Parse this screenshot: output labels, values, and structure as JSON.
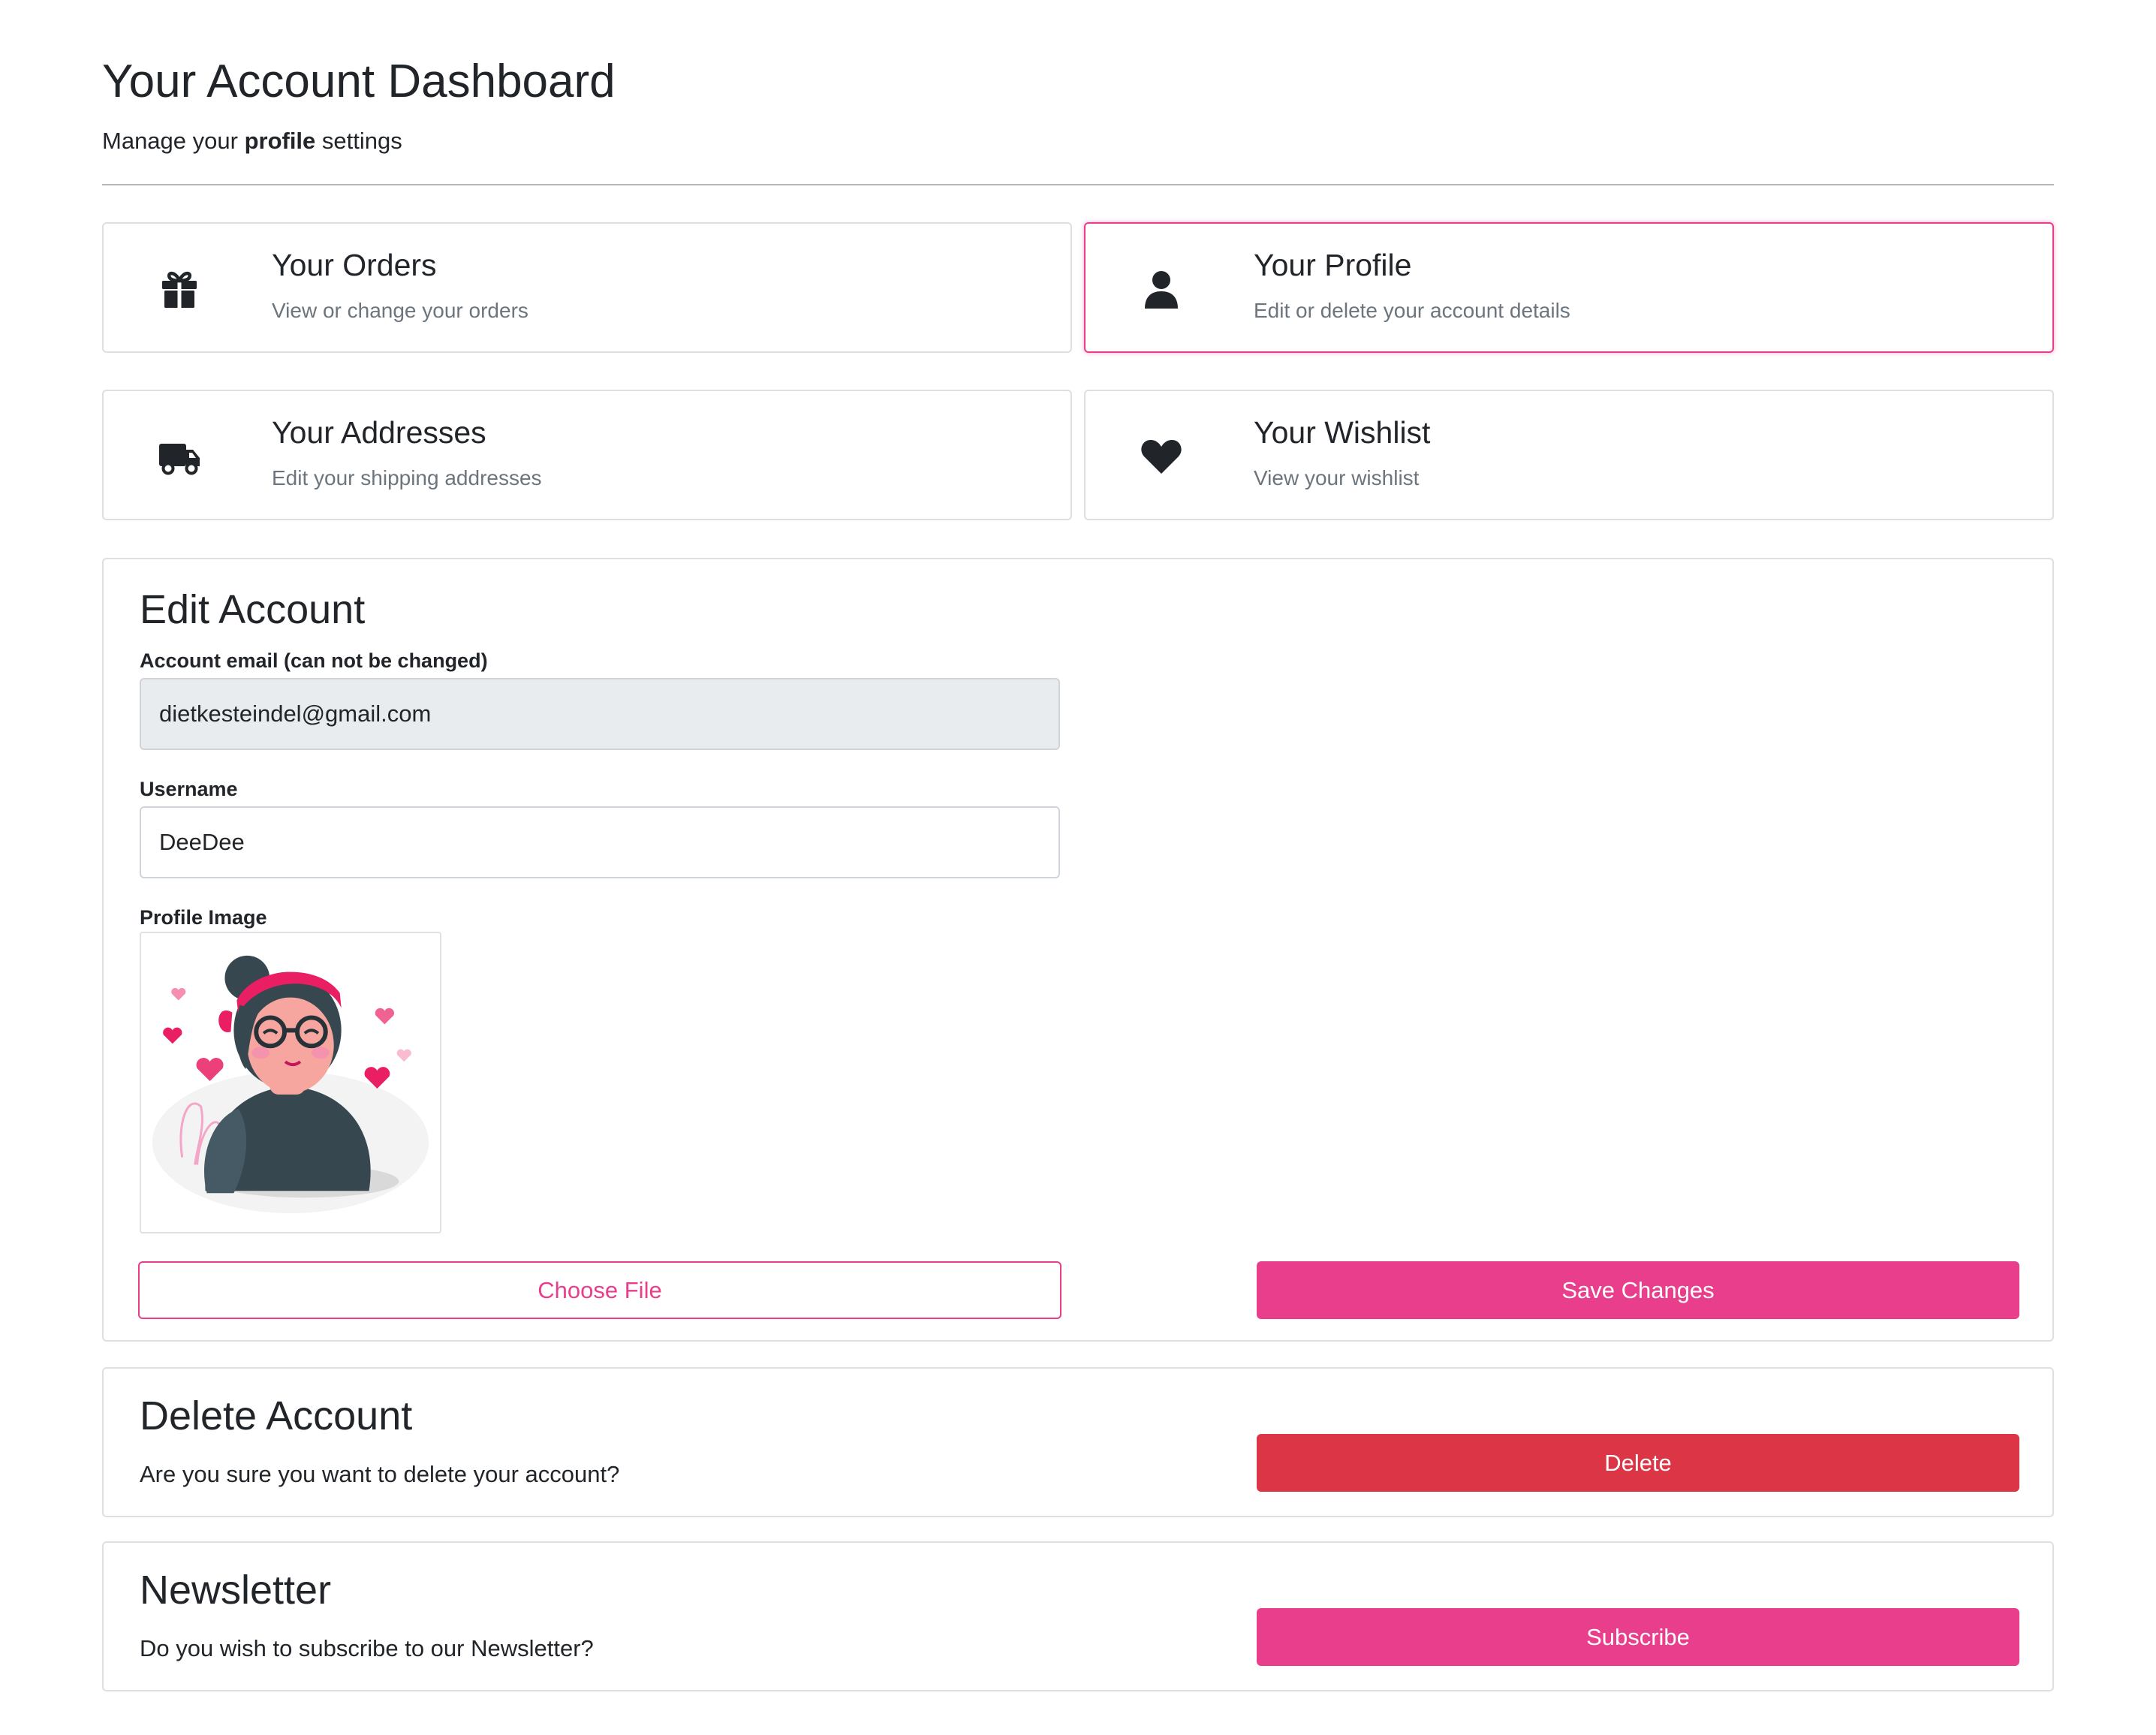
{
  "header": {
    "title": "Your Account Dashboard",
    "subtitle_prefix": "Manage your ",
    "subtitle_bold": "profile",
    "subtitle_suffix": " settings"
  },
  "nav_cards": [
    {
      "title": "Your Orders",
      "description": "View or change your orders",
      "icon": "gift-icon",
      "active": false
    },
    {
      "title": "Your Profile",
      "description": "Edit or delete your account details",
      "icon": "user-icon",
      "active": true
    },
    {
      "title": "Your Addresses",
      "description": "Edit your shipping addresses",
      "icon": "truck-icon",
      "active": false
    },
    {
      "title": "Your Wishlist",
      "description": "View your wishlist",
      "icon": "heart-icon",
      "active": false
    }
  ],
  "edit_account": {
    "title": "Edit Account",
    "email_label": "Account email (can not be changed)",
    "email_value": "dietkesteindel@gmail.com",
    "username_label": "Username",
    "username_value": "DeeDee",
    "profile_image_label": "Profile Image",
    "choose_file_label": "Choose File",
    "save_label": "Save Changes"
  },
  "delete_account": {
    "title": "Delete Account",
    "text": "Are you sure you want to delete your account?",
    "button_label": "Delete"
  },
  "newsletter": {
    "title": "Newsletter",
    "text": "Do you wish to subscribe to our Newsletter?",
    "button_label": "Subscribe"
  },
  "colors": {
    "accent": "#e83e8c",
    "danger": "#dc3545",
    "muted_text": "#6c757d",
    "disabled_field": "#e9ecef"
  }
}
